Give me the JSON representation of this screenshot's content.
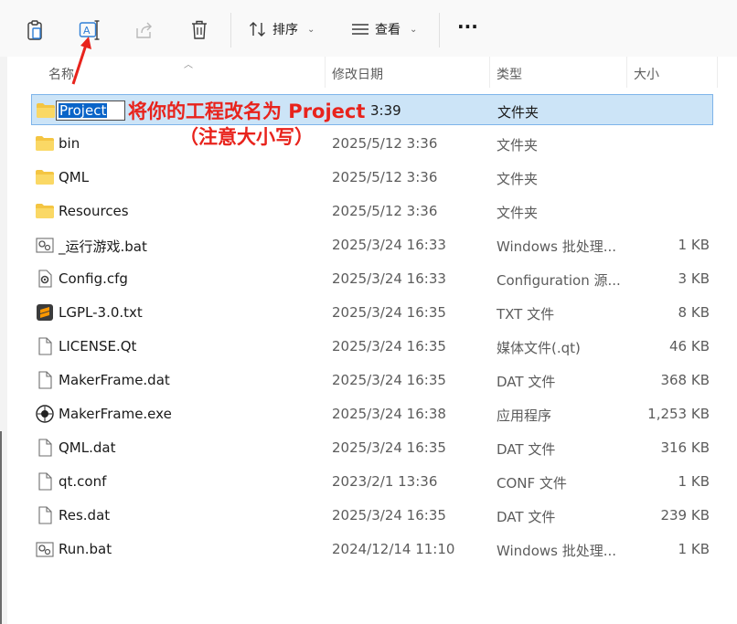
{
  "toolbar": {
    "sort_label": "排序",
    "view_label": "查看",
    "more_label": "···",
    "sort_chevron": "⌄",
    "view_chevron": "⌄"
  },
  "columns": {
    "name": "名称",
    "modified": "修改日期",
    "type": "类型",
    "size": "大小"
  },
  "rename": {
    "value": "Project",
    "partial_date": "3:39",
    "type": "文件夹"
  },
  "annotation": {
    "line1": "将你的工程改名为 Project",
    "line2": "（注意大小写）",
    "color": "#e8231c"
  },
  "files": [
    {
      "name": "bin",
      "modified": "2025/5/12 3:36",
      "type": "文件夹",
      "size": "",
      "icon": "folder-icon"
    },
    {
      "name": "QML",
      "modified": "2025/5/12 3:36",
      "type": "文件夹",
      "size": "",
      "icon": "folder-icon"
    },
    {
      "name": "Resources",
      "modified": "2025/5/12 3:36",
      "type": "文件夹",
      "size": "",
      "icon": "folder-icon"
    },
    {
      "name": "_运行游戏.bat",
      "modified": "2025/3/24 16:33",
      "type": "Windows 批处理...",
      "size": "1 KB",
      "icon": "batch-file-icon"
    },
    {
      "name": "Config.cfg",
      "modified": "2025/3/24 16:33",
      "type": "Configuration 源...",
      "size": "3 KB",
      "icon": "config-file-icon"
    },
    {
      "name": "LGPL-3.0.txt",
      "modified": "2025/3/24 16:35",
      "type": "TXT 文件",
      "size": "8 KB",
      "icon": "sublime-text-icon"
    },
    {
      "name": "LICENSE.Qt",
      "modified": "2025/3/24 16:35",
      "type": "媒体文件(.qt)",
      "size": "46 KB",
      "icon": "file-icon"
    },
    {
      "name": "MakerFrame.dat",
      "modified": "2025/3/24 16:35",
      "type": "DAT 文件",
      "size": "368 KB",
      "icon": "file-icon"
    },
    {
      "name": "MakerFrame.exe",
      "modified": "2025/3/24 16:38",
      "type": "应用程序",
      "size": "1,253 KB",
      "icon": "app-icon"
    },
    {
      "name": "QML.dat",
      "modified": "2025/3/24 16:35",
      "type": "DAT 文件",
      "size": "316 KB",
      "icon": "file-icon"
    },
    {
      "name": "qt.conf",
      "modified": "2023/2/1 13:36",
      "type": "CONF 文件",
      "size": "1 KB",
      "icon": "file-icon"
    },
    {
      "name": "Res.dat",
      "modified": "2025/3/24 16:35",
      "type": "DAT 文件",
      "size": "239 KB",
      "icon": "file-icon"
    },
    {
      "name": "Run.bat",
      "modified": "2024/12/14 11:10",
      "type": "Windows 批处理...",
      "size": "1 KB",
      "icon": "batch-file-icon"
    }
  ]
}
